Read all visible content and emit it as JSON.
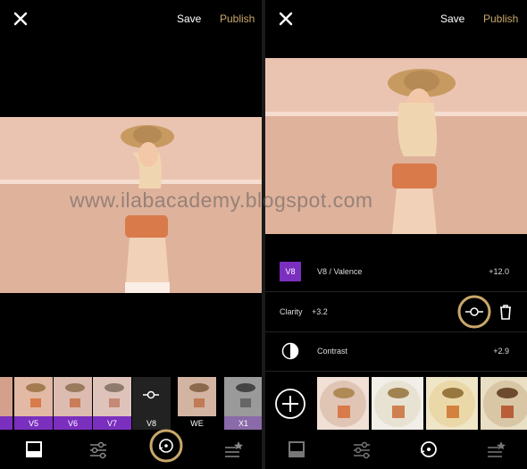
{
  "left": {
    "top": {
      "save": "Save",
      "publish": "Publish"
    },
    "presets": [
      {
        "label": "",
        "tint": "#7b2fbf"
      },
      {
        "label": "V5",
        "tint": "#7b2fbf"
      },
      {
        "label": "V6",
        "tint": "#7b2fbf"
      },
      {
        "label": "V7",
        "tint": "#7b2fbf"
      },
      {
        "label": "V8",
        "tint": "#222222"
      },
      {
        "label": "WE",
        "tint": "#000000"
      },
      {
        "label": "X1",
        "tint": "#8a6aa8"
      }
    ]
  },
  "right": {
    "top": {
      "save": "Save",
      "publish": "Publish"
    },
    "edits": [
      {
        "name": "V8 / Valence",
        "value": "+12.0",
        "badge": "V8"
      },
      {
        "name": "Clarity",
        "value": "+3.2"
      },
      {
        "name": "Contrast",
        "value": "+2.9"
      }
    ]
  },
  "watermark": "www.ilabacademy.blogspot.com",
  "colors": {
    "accent": "#c9a86a",
    "purple": "#7b2fbf",
    "photo_bg": "#e6b9a3"
  }
}
